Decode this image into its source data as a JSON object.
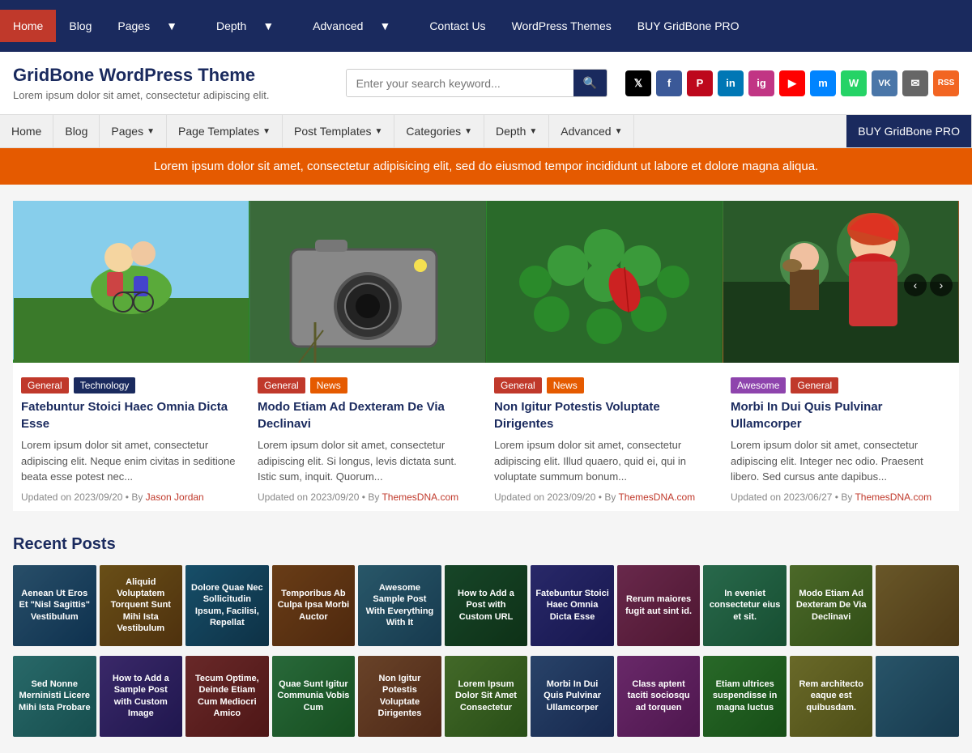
{
  "topNav": {
    "items": [
      {
        "label": "Home",
        "active": true
      },
      {
        "label": "Blog",
        "active": false
      },
      {
        "label": "Pages",
        "hasDropdown": true
      },
      {
        "label": "Depth",
        "hasDropdown": true
      },
      {
        "label": "Advanced",
        "hasDropdown": true
      },
      {
        "label": "Contact Us",
        "active": false
      },
      {
        "label": "WordPress Themes",
        "active": false
      },
      {
        "label": "BUY GridBone PRO",
        "active": false
      }
    ]
  },
  "header": {
    "siteTitle": "GridBone WordPress Theme",
    "tagline": "Lorem ipsum dolor sit amet, consectetur adipiscing elit.",
    "searchPlaceholder": "Enter your search keyword...",
    "searchLabel": "🔍"
  },
  "socialIcons": [
    {
      "name": "twitter-icon",
      "label": "𝕏",
      "color": "#000000"
    },
    {
      "name": "facebook-icon",
      "label": "f",
      "color": "#3b5998"
    },
    {
      "name": "pinterest-icon",
      "label": "P",
      "color": "#bd081c"
    },
    {
      "name": "linkedin-icon",
      "label": "in",
      "color": "#0077b5"
    },
    {
      "name": "instagram-icon",
      "label": "ig",
      "color": "#c13584"
    },
    {
      "name": "youtube-icon",
      "label": "▶",
      "color": "#ff0000"
    },
    {
      "name": "messenger-icon",
      "label": "m",
      "color": "#0084ff"
    },
    {
      "name": "whatsapp-icon",
      "label": "W",
      "color": "#25d366"
    },
    {
      "name": "vk-icon",
      "label": "VK",
      "color": "#4a76a8"
    },
    {
      "name": "email-icon",
      "label": "✉",
      "color": "#666"
    },
    {
      "name": "rss-icon",
      "label": "RSS",
      "color": "#f26522"
    }
  ],
  "secondaryNav": {
    "items": [
      {
        "label": "Home"
      },
      {
        "label": "Blog"
      },
      {
        "label": "Pages",
        "hasDropdown": true
      },
      {
        "label": "Page Templates",
        "hasDropdown": true
      },
      {
        "label": "Post Templates",
        "hasDropdown": true
      },
      {
        "label": "Categories",
        "hasDropdown": true
      },
      {
        "label": "Depth",
        "hasDropdown": true
      },
      {
        "label": "Advanced",
        "hasDropdown": true
      },
      {
        "label": "BUY GridBone PRO",
        "isBuy": true
      }
    ]
  },
  "banner": {
    "text": "Lorem ipsum dolor sit amet, consectetur adipisicing elit, sed do eiusmod tempor incididunt ut labore et dolore magna aliqua."
  },
  "featuredPosts": [
    {
      "imgClass": "img-couple",
      "imgEmoji": "👫🚲",
      "tags": [
        {
          "label": "General",
          "class": "tag-general"
        },
        {
          "label": "Technology",
          "class": "tag-technology"
        }
      ],
      "title": "Fatebuntur Stoici Haec Omnia Dicta Esse",
      "excerpt": "Lorem ipsum dolor sit amet, consectetur adipiscing elit. Neque enim civitas in seditione beata esse potest nec...",
      "updated": "2023/09/20",
      "author": "Jason Jordan",
      "authorIsLink": true
    },
    {
      "imgClass": "img-camera",
      "imgEmoji": "📷",
      "tags": [
        {
          "label": "General",
          "class": "tag-general"
        },
        {
          "label": "News",
          "class": "tag-news"
        }
      ],
      "title": "Modo Etiam Ad Dexteram De Via Declinavi",
      "excerpt": "Lorem ipsum dolor sit amet, consectetur adipiscing elit. Si longus, levis dictata sunt. Istic sum, inquit. Quorum...",
      "updated": "2023/09/20",
      "author": "ThemesDNA.com",
      "authorIsLink": true
    },
    {
      "imgClass": "img-leaf",
      "imgEmoji": "🍃🍂",
      "tags": [
        {
          "label": "General",
          "class": "tag-general"
        },
        {
          "label": "News",
          "class": "tag-news"
        }
      ],
      "title": "Non Igitur Potestis Voluptate Dirigentes",
      "excerpt": "Lorem ipsum dolor sit amet, consectetur adipiscing elit. Illud quaero, quid ei, qui in voluptate summum bonum...",
      "updated": "2023/09/20",
      "author": "ThemesDNA.com",
      "authorIsLink": true
    },
    {
      "imgClass": "img-woman",
      "imgEmoji": "👩",
      "tags": [
        {
          "label": "Awesome",
          "class": "tag-awesome"
        },
        {
          "label": "General",
          "class": "tag-general"
        }
      ],
      "title": "Morbi In Dui Quis Pulvinar Ullamcorper",
      "excerpt": "Lorem ipsum dolor sit amet, consectetur adipiscing elit. Integer nec odio. Praesent libero. Sed cursus ante dapibus...",
      "updated": "2023/06/27",
      "author": "ThemesDNA.com",
      "authorIsLink": true,
      "hasCarousel": true
    }
  ],
  "recentPosts": {
    "heading": "Recent Posts",
    "row1": [
      {
        "bgClass": "rc1",
        "title": "Aenean Ut Eros Et \"Nisl Sagittis\" Vestibulum"
      },
      {
        "bgClass": "rc2",
        "title": "Aliquid Voluptatem Torquent Sunt Mihi Ista Vestibulum"
      },
      {
        "bgClass": "rc3",
        "title": "Dolore Quae Nec Sollicitudin Ipsum, Facilisi, Repellat"
      },
      {
        "bgClass": "rc4",
        "title": "Temporibus Ab Culpa Ipsa Morbi Auctor"
      },
      {
        "bgClass": "rc5",
        "title": "Awesome Sample Post With Everything With It"
      },
      {
        "bgClass": "rc6",
        "title": "How to Add a Post with Custom URL"
      },
      {
        "bgClass": "rc7",
        "title": "Fatebuntur Stoici Haec Omnia Dicta Esse"
      },
      {
        "bgClass": "rc8",
        "title": "Rerum maiores fugit aut sint id."
      },
      {
        "bgClass": "rc9",
        "title": "In eveniet consectetur eius et sit."
      },
      {
        "bgClass": "rc10",
        "title": "Modo Etiam Ad Dexteram De Via Declinavi"
      },
      {
        "bgClass": "rc11",
        "title": ""
      }
    ],
    "row2": [
      {
        "bgClass": "rc12",
        "title": "Sed Nonne Merninisti Licere Mihi Ista Probare"
      },
      {
        "bgClass": "rc13",
        "title": "How to Add a Sample Post with Custom Image"
      },
      {
        "bgClass": "rc14",
        "title": "Tecum Optime, Deinde Etiam Cum Mediocri Amico"
      },
      {
        "bgClass": "rc15",
        "title": "Quae Sunt Igitur Communia Vobis Cum"
      },
      {
        "bgClass": "rc16",
        "title": "Non Igitur Potestis Voluptate Dirigentes"
      },
      {
        "bgClass": "rc17",
        "title": "Lorem Ipsum Dolor Sit Amet Consectetur"
      },
      {
        "bgClass": "rc18",
        "title": "Morbi In Dui Quis Pulvinar Ullamcorper"
      },
      {
        "bgClass": "rc19",
        "title": "Class aptent taciti sociosqu ad torquen"
      },
      {
        "bgClass": "rc20",
        "title": "Etiam ultrices suspendisse in magna luctus"
      },
      {
        "bgClass": "rc21",
        "title": "Rem architecto eaque est quibusdam."
      },
      {
        "bgClass": "rc22",
        "title": ""
      }
    ]
  }
}
